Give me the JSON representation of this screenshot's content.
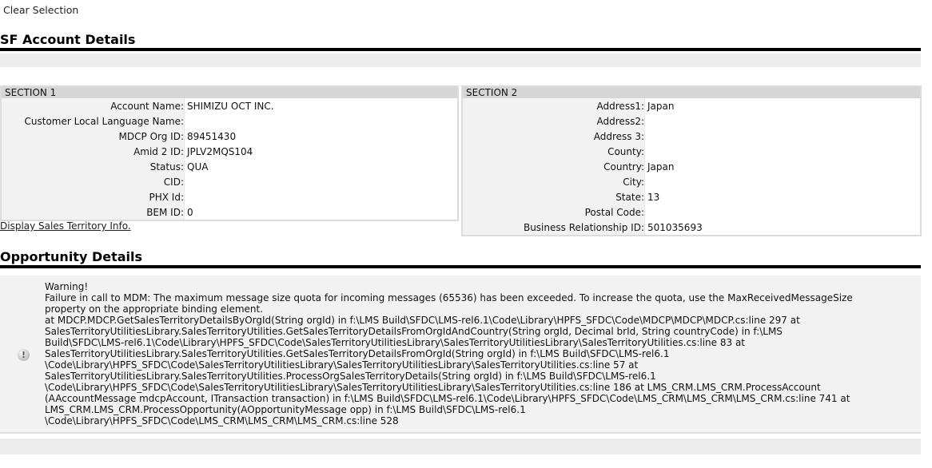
{
  "clear_selection": "Clear Selection",
  "sf_account": {
    "title": "SF Account Details",
    "section1": {
      "header": "SECTION 1",
      "fields": [
        {
          "label": "Account Name:",
          "value": "SHIMIZU OCT INC."
        },
        {
          "label": "Customer Local Language Name:",
          "value": ""
        },
        {
          "label": "MDCP Org ID:",
          "value": "89451430"
        },
        {
          "label": "Amid 2 ID:",
          "value": "JPLV2MQS104"
        },
        {
          "label": "Status:",
          "value": "QUA"
        },
        {
          "label": "CID:",
          "value": ""
        },
        {
          "label": "PHX Id:",
          "value": ""
        },
        {
          "label": "BEM ID:",
          "value": "0"
        }
      ],
      "link": "Display Sales Territory Info."
    },
    "section2": {
      "header": "SECTION 2",
      "fields": [
        {
          "label": "Address1:",
          "value": "Japan"
        },
        {
          "label": "Address2:",
          "value": ""
        },
        {
          "label": "Address 3:",
          "value": ""
        },
        {
          "label": "County:",
          "value": ""
        },
        {
          "label": "Country:",
          "value": "Japan"
        },
        {
          "label": "City:",
          "value": ""
        },
        {
          "label": "State:",
          "value": "13"
        },
        {
          "label": "Postal Code:",
          "value": ""
        },
        {
          "label": "Business Relationship ID:",
          "value": "501035693"
        }
      ]
    }
  },
  "opportunity": {
    "title": "Opportunity Details",
    "warning_lines": [
      "Warning!",
      "Failure in call to MDM: The maximum message size quota for incoming messages (65536) has been exceeded. To increase the quota, use the MaxReceivedMessageSize",
      "property on the appropriate binding element.",
      "at MDCP.MDCP.GetSalesTerritoryDetailsByOrgId(String orgId) in f:\\LMS Build\\SFDC\\LMS-rel6.1\\Code\\Library\\HPFS_SFDC\\Code\\MDCP\\MDCP\\MDCP.cs:line 297 at",
      "SalesTerritoryUtilitiesLibrary.SalesTerritoryUtilities.GetSalesTerritoryDetailsFromOrgIdAndCountry(String orgId, Decimal brId, String countryCode) in f:\\LMS",
      "Build\\SFDC\\LMS-rel6.1\\Code\\Library\\HPFS_SFDC\\Code\\SalesTerritoryUtilitiesLibrary\\SalesTerritoryUtilitiesLibrary\\SalesTerritoryUtilities.cs:line 83 at",
      "SalesTerritoryUtilitiesLibrary.SalesTerritoryUtilities.GetSalesTerritoryDetailsFromOrgId(String orgId) in f:\\LMS Build\\SFDC\\LMS-rel6.1",
      "\\Code\\Library\\HPFS_SFDC\\Code\\SalesTerritoryUtilitiesLibrary\\SalesTerritoryUtilitiesLibrary\\SalesTerritoryUtilities.cs:line 57 at",
      "SalesTerritoryUtilitiesLibrary.SalesTerritoryUtilities.ProcessOrgSalesTerritoryDetails(String orgId) in f:\\LMS Build\\SFDC\\LMS-rel6.1",
      "\\Code\\Library\\HPFS_SFDC\\Code\\SalesTerritoryUtilitiesLibrary\\SalesTerritoryUtilitiesLibrary\\SalesTerritoryUtilities.cs:line 186 at LMS_CRM.LMS_CRM.ProcessAccount",
      "(AAccountMessage mdcpAccount, ITransaction transaction) in f:\\LMS Build\\SFDC\\LMS-rel6.1\\Code\\Library\\HPFS_SFDC\\Code\\LMS_CRM\\LMS_CRM\\LMS_CRM.cs:line 741 at",
      "LMS_CRM.LMS_CRM.ProcessOpportunity(AOpportunityMessage opp) in f:\\LMS Build\\SFDC\\LMS-rel6.1",
      "\\Code\\Library\\HPFS_SFDC\\Code\\LMS_CRM\\LMS_CRM\\LMS_CRM.cs:line 528"
    ],
    "icon": "warning-icon"
  }
}
